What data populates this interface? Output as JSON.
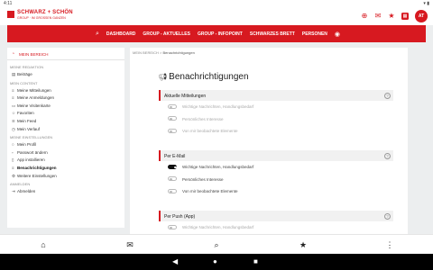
{
  "status_bar": {
    "time": "4:11"
  },
  "brand": {
    "name": "SCHWARZ + SCHÖN",
    "tagline": "GROUP · IM GROSSEN GANZEN"
  },
  "user": {
    "initials": "AT"
  },
  "colors": {
    "accent": "#d71920",
    "toggle_on": "#111111"
  },
  "nav": {
    "items": [
      "DASHBOARD",
      "GROUP - AKTUELLES",
      "GROUP - INFOPOINT",
      "SCHWARZES BRETT",
      "PERSONEN"
    ]
  },
  "sidebar": {
    "header": "MEIN BEREICH",
    "sections": [
      {
        "title": "MEINE REDAKTION",
        "items": [
          {
            "label": "Beiträge"
          }
        ]
      },
      {
        "title": "MEIN CONTENT",
        "items": [
          {
            "label": "Meine Mitteilungen"
          },
          {
            "label": "Meine Anmeldungen"
          },
          {
            "label": "Meine Visitenkarte"
          },
          {
            "label": "Favoriten"
          },
          {
            "label": "Mein Feed"
          },
          {
            "label": "Mein Verlauf"
          }
        ]
      },
      {
        "title": "MEINE EINSTELLUNGEN",
        "items": [
          {
            "label": "Mein Profil"
          },
          {
            "label": "Passwort ändern"
          },
          {
            "label": "App installieren"
          },
          {
            "label": "Benachrichtigungen"
          },
          {
            "label": "Weitere Einstellungen"
          }
        ]
      },
      {
        "title": "ANMELDEN",
        "items": [
          {
            "label": "Abmelden"
          }
        ]
      }
    ]
  },
  "breadcrumb": {
    "root": "MEIN BEREICH",
    "separator": ">",
    "current": "Benachrichtigungen"
  },
  "page": {
    "title": "Benachrichtigungen"
  },
  "sections": [
    {
      "title": "Aktuelle Mitteilungen",
      "options": [
        {
          "label": "Wichtige Nachrichten, Handlungsbedarf",
          "enabled": false
        },
        {
          "label": "Persönliches Interesse",
          "enabled": false
        },
        {
          "label": "Von mir beobachtete Elemente",
          "enabled": false
        }
      ]
    },
    {
      "title": "Per E-Mail",
      "options": [
        {
          "label": "Wichtige Nachrichten, Handlungsbedarf",
          "enabled": true
        },
        {
          "label": "Persönliches Interesse",
          "enabled": false
        },
        {
          "label": "Von mir beobachtete Elemente",
          "enabled": false
        }
      ]
    },
    {
      "title": "Per Push (App)",
      "options": [
        {
          "label": "Wichtige Nachrichten, Handlungsbedarf",
          "enabled": false
        }
      ]
    }
  ]
}
